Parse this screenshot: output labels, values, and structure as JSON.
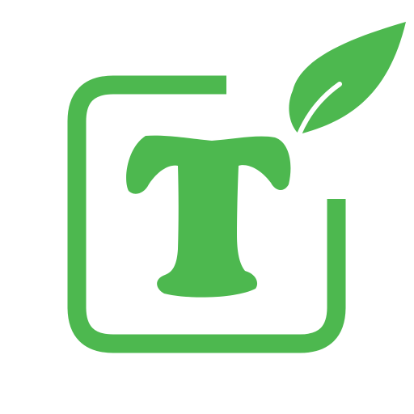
{
  "logo": {
    "letter": "T",
    "icon": "leaf-icon",
    "color": "#4db84f"
  }
}
